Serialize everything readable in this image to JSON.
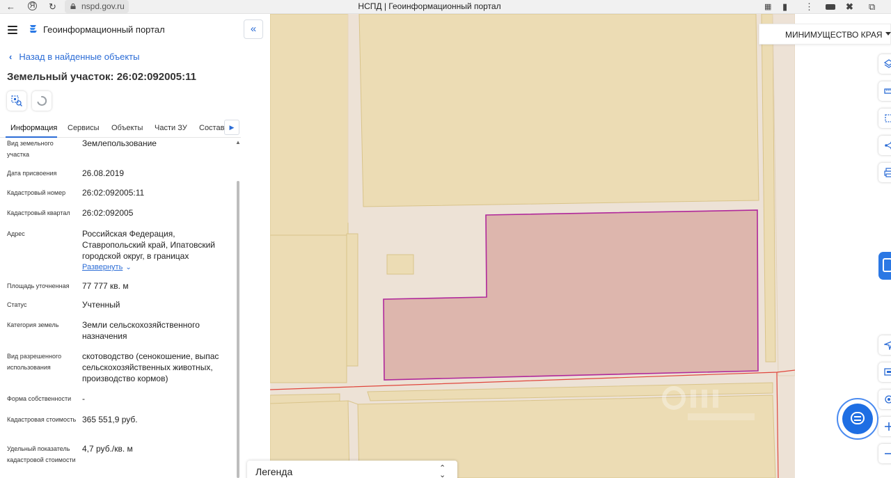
{
  "browser": {
    "url": "nspd.gov.ru",
    "tab_title": "НСПД | Геоинформационный портал"
  },
  "header": {
    "portal_name": "Геоинформационный портал"
  },
  "panel": {
    "back_label": "Назад в найденные объекты",
    "title": "Земельный участок: 26:02:092005:11",
    "tabs": [
      {
        "label": "Информация",
        "active": true
      },
      {
        "label": "Сервисы",
        "active": false
      },
      {
        "label": "Объекты",
        "active": false
      },
      {
        "label": "Части ЗУ",
        "active": false
      },
      {
        "label": "Состав",
        "active": false
      }
    ],
    "info": [
      {
        "label": "Вид земельного участка",
        "value": "Землепользование"
      },
      {
        "label": "Дата присвоения",
        "value": "26.08.2019"
      },
      {
        "label": "Кадастровый номер",
        "value": "26:02:092005:11"
      },
      {
        "label": "Кадастровый квартал",
        "value": "26:02:092005"
      },
      {
        "label": "Адрес",
        "value": "Российская Федерация, Ставропольский край, Ипатовский городской округ, в границах",
        "expand": "Развернуть"
      },
      {
        "label": "Площадь уточненная",
        "value": "77 777 кв. м"
      },
      {
        "label": "Статус",
        "value": "Учтенный"
      },
      {
        "label": "Категория земель",
        "value": "Земли сельскохозяйственного назначения"
      },
      {
        "label": "Вид разрешенного использования",
        "value": "скотоводство (сенокошение, выпас сельскохозяйственных животных, производство кормов)"
      },
      {
        "label": "Форма собственности",
        "value": "-"
      },
      {
        "label": "Кадастровая стоимость",
        "value": "365 551,9 руб."
      },
      {
        "label": "Удельный показатель кадастровой стоимости",
        "value": "4,7 руб./кв. м"
      }
    ]
  },
  "map": {
    "layer_selector": "МИНИМУЩЕСТВО КРАЯ",
    "legend_title": "Легенда",
    "colors": {
      "background": "#ede2d6",
      "field": "#ecdcb4",
      "field_border": "#d9c48a",
      "selected_fill": "#ddb6ad",
      "selected_border": "#b0289b",
      "boundary_line": "#e0463c"
    }
  }
}
